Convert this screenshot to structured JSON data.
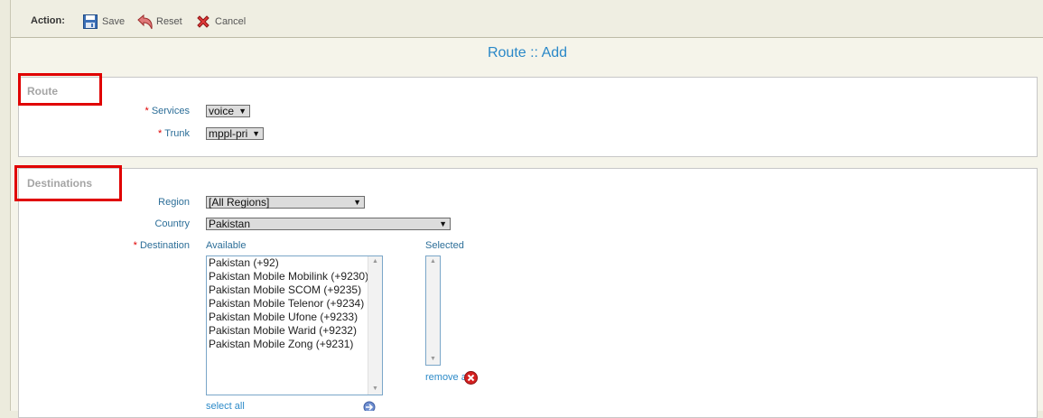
{
  "toolbar": {
    "action_label": "Action:",
    "save_label": "Save",
    "reset_label": "Reset",
    "cancel_label": "Cancel"
  },
  "page_title": "Route :: Add",
  "route_section": {
    "legend": "Route",
    "services_label": "Services",
    "services_value": "voice",
    "trunk_label": "Trunk",
    "trunk_value": "mppl-pri"
  },
  "destinations_section": {
    "legend": "Destinations",
    "region_label": "Region",
    "region_value": "[All Regions]",
    "country_label": "Country",
    "country_value": "Pakistan",
    "destination_label": "Destination",
    "available_label": "Available",
    "selected_label": "Selected",
    "available_items": [
      "Pakistan (+92)",
      "Pakistan Mobile Mobilink (+9230)",
      "Pakistan Mobile SCOM (+9235)",
      "Pakistan Mobile Telenor (+9234)",
      "Pakistan Mobile Ufone (+9233)",
      "Pakistan Mobile Warid (+9232)",
      "Pakistan Mobile Zong (+9231)"
    ],
    "selected_items": [],
    "select_all_label": "select all",
    "remove_all_label": "remove all"
  },
  "required_marker": "*",
  "colors": {
    "title_blue": "#2a88c8",
    "label_blue": "#2c6e98",
    "highlight_red": "#e00000"
  }
}
